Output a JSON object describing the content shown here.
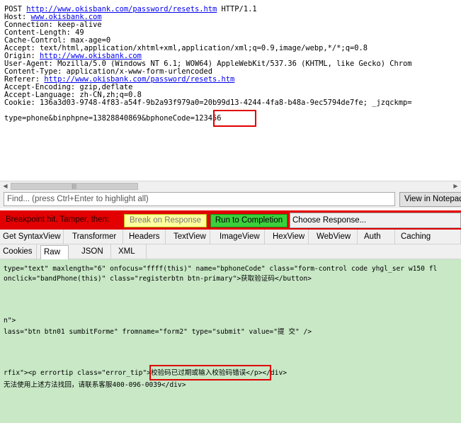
{
  "request": {
    "lines": [
      {
        "pre": "POST ",
        "link": "http://www.okisbank.com/password/resets.htm",
        "post": " HTTP/1.1"
      },
      {
        "pre": "Host: ",
        "link": "www.okisbank.com",
        "post": ""
      },
      {
        "pre": "Connection: keep-alive",
        "link": "",
        "post": ""
      },
      {
        "pre": "Content-Length: 49",
        "link": "",
        "post": ""
      },
      {
        "pre": "Cache-Control: max-age=0",
        "link": "",
        "post": ""
      },
      {
        "pre": "Accept: text/html,application/xhtml+xml,application/xml;q=0.9,image/webp,*/*;q=0.8",
        "link": "",
        "post": ""
      },
      {
        "pre": "Origin: ",
        "link": "http://www.okisbank.com",
        "post": ""
      },
      {
        "pre": "User-Agent: Mozilla/5.0 (Windows NT 6.1; WOW64) AppleWebKit/537.36 (KHTML, like Gecko) Chrom",
        "link": "",
        "post": ""
      },
      {
        "pre": "Content-Type: application/x-www-form-urlencoded",
        "link": "",
        "post": ""
      },
      {
        "pre": "Referer: ",
        "link": "http://www.okisbank.com/password/resets.htm",
        "post": ""
      },
      {
        "pre": "Accept-Encoding: gzip,deflate",
        "link": "",
        "post": ""
      },
      {
        "pre": "Accept-Language: zh-CN,zh;q=0.8",
        "link": "",
        "post": ""
      },
      {
        "pre": "Cookie: 136a3d03-9748-4f83-a54f-9b2a93f979a0=20b99d13-4244-4fa8-b48a-9ec5794de7fe; _jzqckmp=",
        "link": "",
        "post": ""
      }
    ],
    "body_prefix": "type=phone&binphpne=13828840869&bphoneCode=",
    "body_code": "123456"
  },
  "scrollbar": {
    "left_arrow": "◀",
    "grip": "|||",
    "right_arrow": "▶"
  },
  "find": {
    "placeholder": "Find... (press Ctrl+Enter to highlight all)"
  },
  "notepad_button": "View in Notepad",
  "breakpoint": {
    "label": "Breakpoint hit. Tamper, then:",
    "break_on_response": "Break on Response",
    "run_to_completion": "Run to Completion",
    "choose_response": "Choose Response..."
  },
  "tabs_row1": [
    "Get SyntaxView",
    "Transformer",
    "Headers",
    "TextView",
    "ImageView",
    "HexView",
    "WebView",
    "Auth",
    "Caching"
  ],
  "tabs_row2": [
    "Cookies",
    "Raw",
    "JSON",
    "XML"
  ],
  "active_tab": "Raw",
  "response": {
    "line1": "type=\"text\" maxlength=\"6\" onfocus=\"ffff(this)\" name=\"bphoneCode\" class=\"form-control code yhgl_ser w150 fl",
    "line2": "onclick=\"bandPhone(this)\" class=\"registerbtn btn-primary\">获取验证码</button>",
    "line3": "n\">",
    "line4": "lass=\"btn btn01 sumbitForme\" fromname=\"form2\" type=\"submit\" value=\"提 交\" />",
    "line5_pre": "rfix\"><p errortip class=\"error_tip\"",
    "line5_msg": ">校验码已过期或输入校验码错误<",
    "line5_post": "/p></div>",
    "line6": "无法使用上述方法找回，请联系客服400-096-0039</div>"
  }
}
